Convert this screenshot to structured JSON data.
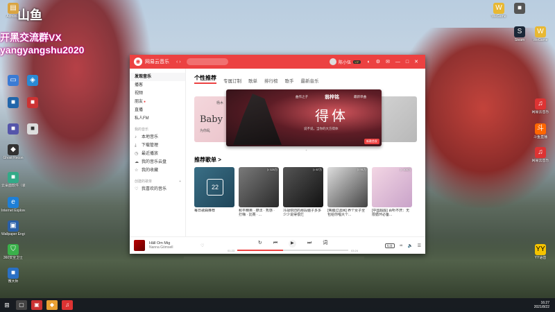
{
  "stream_overlay": {
    "logo": "山鱼",
    "line1": "开黑交流群VX",
    "line2": "yangyangshu2020"
  },
  "desktop_left_icons": [
    {
      "label": "Admini...",
      "icon": "user-folder-icon"
    },
    {
      "label": "",
      "icon": "computer-icon"
    },
    {
      "label": "",
      "icon": "network-icon"
    },
    {
      "label": "",
      "icon": "app-icon"
    },
    {
      "label": "",
      "icon": "app-icon"
    },
    {
      "label": "",
      "icon": "app-icon"
    },
    {
      "label": "",
      "icon": "app-icon"
    },
    {
      "label": "Ghost Recon",
      "icon": "game-icon"
    },
    {
      "label": "云桌面软件（装在下载游戏）",
      "icon": "app-icon"
    },
    {
      "label": "Internet Explorer",
      "icon": "ie-icon"
    },
    {
      "label": "Wallpaper Engine: ...",
      "icon": "wallpaper-icon"
    },
    {
      "label": "360安全卫士",
      "icon": "shield-icon"
    },
    {
      "label": "微大师",
      "icon": "app-icon"
    }
  ],
  "desktop_right_icons": [
    {
      "label": "WeGame",
      "icon": "wegame-icon"
    },
    {
      "label": "",
      "icon": "app-icon"
    },
    {
      "label": "Steam",
      "icon": "steam-icon"
    },
    {
      "label": "WeGame",
      "icon": "wegame-icon"
    },
    {
      "label": "网易云音乐",
      "icon": "music-icon"
    },
    {
      "label": "斗鱼直播",
      "icon": "douyu-icon"
    },
    {
      "label": "网易云音乐",
      "icon": "music-icon"
    },
    {
      "label": "YY语音",
      "icon": "yy-icon"
    }
  ],
  "window": {
    "app_title": "网易云音乐",
    "user_name": "陈小伍",
    "vip_label": "VIP",
    "sidebar": {
      "items": [
        {
          "label": "发现音乐",
          "active": true,
          "icon": ""
        },
        {
          "label": "播客",
          "icon": ""
        },
        {
          "label": "视频",
          "icon": ""
        },
        {
          "label": "朋友",
          "icon": "",
          "dot": true
        },
        {
          "label": "直播",
          "icon": ""
        },
        {
          "label": "私人FM",
          "icon": ""
        }
      ],
      "group_my": "我的音乐",
      "my_items": [
        {
          "label": "本地音乐",
          "icon": "music-note-icon"
        },
        {
          "label": "下载管理",
          "icon": "download-icon"
        },
        {
          "label": "最近播放",
          "icon": "clock-icon"
        },
        {
          "label": "我的音乐云盘",
          "icon": "cloud-icon"
        },
        {
          "label": "我的收藏",
          "icon": "star-icon"
        }
      ],
      "group_created": "创建的歌单",
      "created_items": [
        {
          "label": "我喜欢的音乐",
          "icon": "heart-icon"
        }
      ]
    },
    "tabs": [
      "个性推荐",
      "专属订制",
      "歌单",
      "排行榜",
      "歌手",
      "最新音乐"
    ],
    "banner": {
      "small_left": "曲作之子",
      "artist": "翁梓铭",
      "new_label": "最新单曲",
      "title": "得体",
      "sub": "说不说，当你的大方得体",
      "tag": "新歌首发",
      "left_peek_top": "杨木",
      "left_peek": "Baby",
      "left_peek_sub": "为你乱"
    },
    "section_title": "推荐歌单 >",
    "playlists": [
      {
        "caption": "每日歌曲推荐",
        "count": "",
        "style": "calendar",
        "day": "22"
      },
      {
        "caption": "和平精英 · 撩法 · 秀感 · 打嗨 · 比赛 · ...",
        "count": "▷ 120万"
      },
      {
        "caption": "冷战依旧的那段脑子多多少少说得很烂",
        "count": "▷ 67万"
      },
      {
        "caption": "[焦脑过滤网] 养个女子全包给你唱大个...",
        "count": "▷ 91万"
      },
      {
        "caption": "[中国超超] 百听不厌：无限循环必备...",
        "count": "▷ 400万"
      }
    ],
    "player": {
      "song": "Hâll Om Mig",
      "artist": "Nanna Gömsell",
      "time_current": "01:23",
      "time_total": "03:24",
      "progress": 0.41,
      "quality": "标准"
    }
  },
  "taskbar": {
    "clock_time": "16:27",
    "clock_date": "2021/8/22"
  },
  "colors": {
    "accent": "#ec4141"
  }
}
